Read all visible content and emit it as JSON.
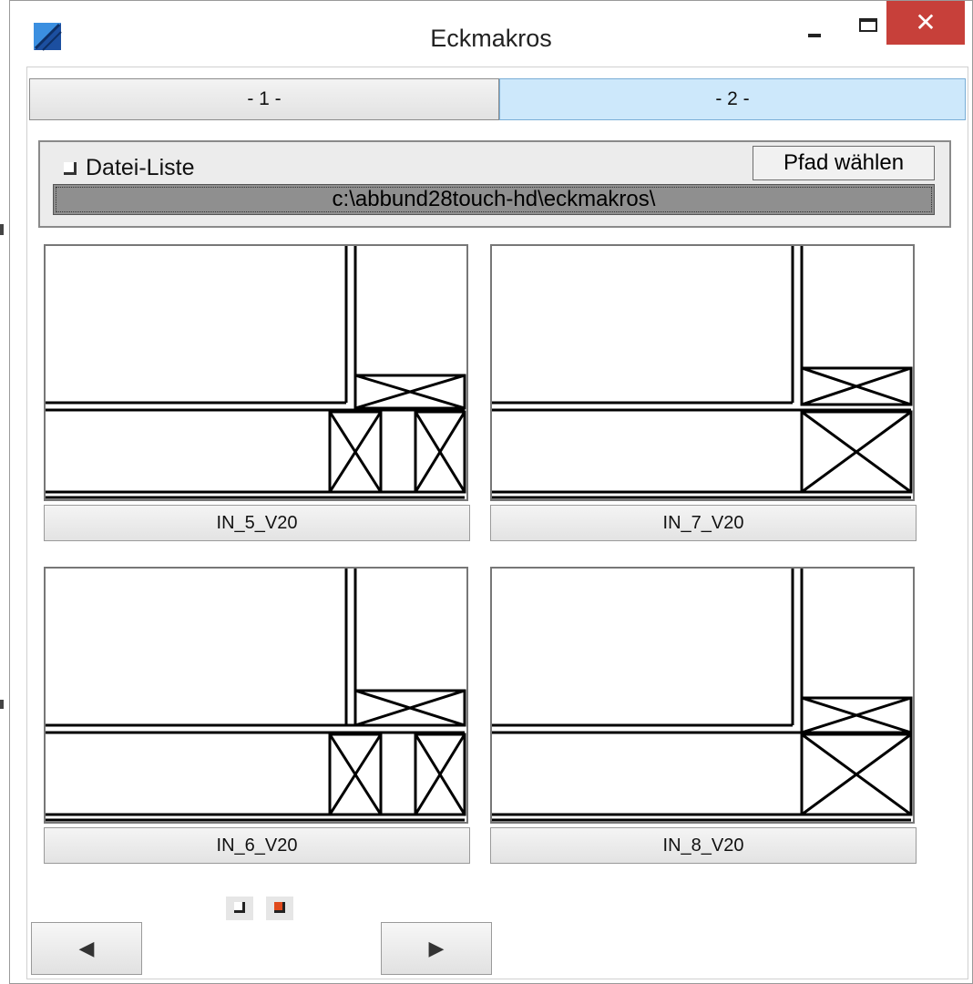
{
  "window": {
    "title": "Eckmakros",
    "close_glyph": "✕",
    "icons": [
      "app-icon",
      "minimize-icon",
      "maximize-icon",
      "close-icon"
    ]
  },
  "tabs": [
    {
      "label": "- 1 -",
      "active": false
    },
    {
      "label": "- 2 -",
      "active": true
    }
  ],
  "path_panel": {
    "checkbox_label": "Datei-Liste",
    "choose_path_label": "Pfad wählen",
    "path_value": "c:\\abbund28touch-hd\\eckmakros\\"
  },
  "macros": [
    {
      "name": "IN_5_V20",
      "variant": "double-post"
    },
    {
      "name": "IN_7_V20",
      "variant": "single-post"
    },
    {
      "name": "IN_6_V20",
      "variant": "double-post"
    },
    {
      "name": "IN_8_V20",
      "variant": "single-post"
    }
  ],
  "pager": {
    "pages": 2,
    "current": 2
  },
  "navigation": {
    "prev_glyph": "◀",
    "next_glyph": "▶"
  },
  "colors": {
    "active_tab": "#cde8fb",
    "close_button": "#c7403a",
    "path_field": "#8f8f8f",
    "current_page": "#e04a1c"
  }
}
